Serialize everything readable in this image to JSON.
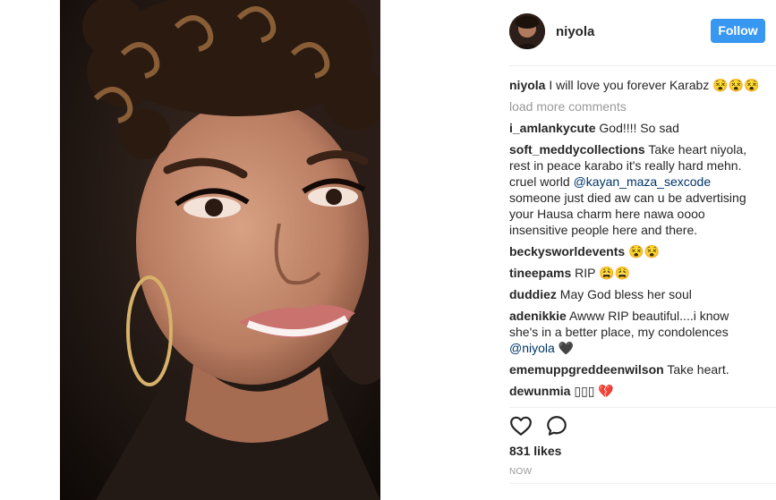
{
  "post": {
    "username": "niyola",
    "follow_label": "Follow",
    "caption": {
      "user": "niyola",
      "text": "I will love you forever Karabz 😵😵😵"
    },
    "load_more": "load more comments",
    "comments": [
      {
        "user": "i_amlankycute",
        "text": "God!!!! So sad"
      },
      {
        "user": "soft_meddycollections",
        "text": "Take heart niyola, rest in peace karabo it's really hard mehn. cruel world ",
        "mention": "@kayan_maza_sexcode",
        "text_after": " someone just died aw can u be advertising your Hausa charm here nawa oooo insensitive people here and there."
      },
      {
        "user": "beckysworldevents",
        "text": "😵😵"
      },
      {
        "user": "tineepams",
        "text": "RIP 😩😩"
      },
      {
        "user": "duddiez",
        "text": "May God bless her soul"
      },
      {
        "user": "adenikkie",
        "text": "Awww RIP beautiful....i know she's in a better place, my condolences ",
        "mention": "@niyola",
        "text_after": " 🖤"
      },
      {
        "user": "ememuppgreddeenwilson",
        "text": "Take heart."
      },
      {
        "user": "dewunmia",
        "text": "▯▯▯ 💔"
      }
    ],
    "likes": "831 likes",
    "timestamp": "NOW"
  },
  "icons": {
    "like": "heart-icon",
    "comment": "speech-bubble-icon"
  },
  "colors": {
    "follow_button": "#3897f0",
    "mention": "#003569",
    "muted": "#999999"
  }
}
